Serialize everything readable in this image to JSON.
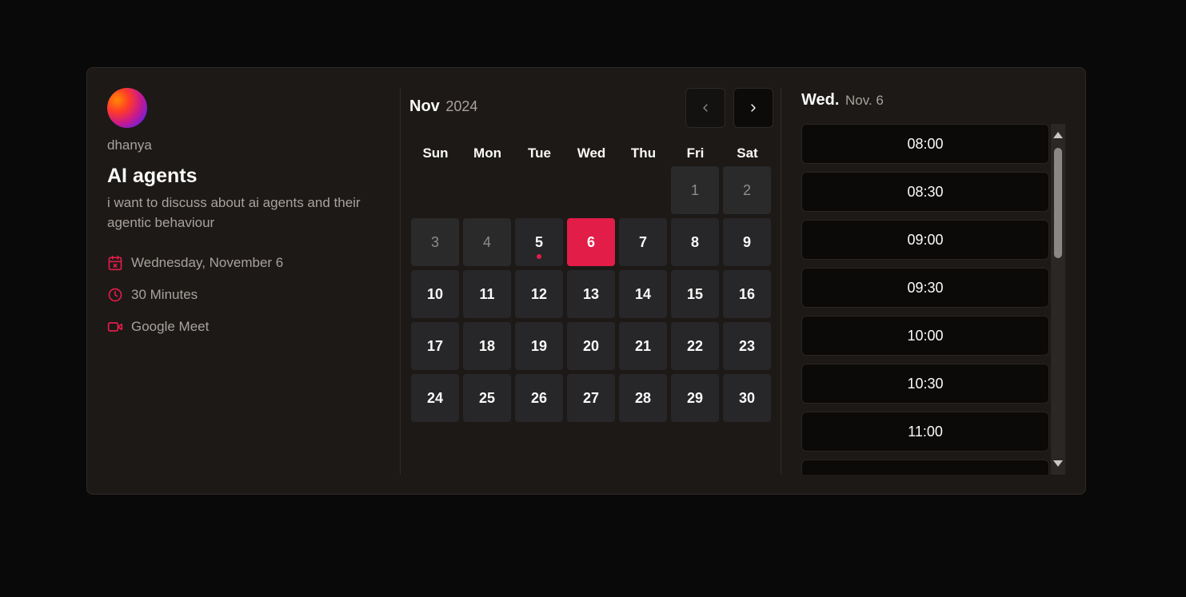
{
  "host": {
    "name": "dhanya"
  },
  "event": {
    "title": "AI agents",
    "description": "i want to discuss about ai agents and their agentic behaviour",
    "date": "Wednesday, November 6",
    "duration": "30 Minutes",
    "location": "Google Meet"
  },
  "calendar": {
    "month": "Nov",
    "year": "2024",
    "prev_icon": "chevron-left-icon",
    "next_icon": "chevron-right-icon",
    "weekdays": [
      "Sun",
      "Mon",
      "Tue",
      "Wed",
      "Thu",
      "Fri",
      "Sat"
    ],
    "days": [
      {
        "day": "1",
        "state": "past"
      },
      {
        "day": "2",
        "state": "past"
      },
      {
        "day": "3",
        "state": "past"
      },
      {
        "day": "4",
        "state": "past"
      },
      {
        "day": "5",
        "state": "today"
      },
      {
        "day": "6",
        "state": "selected"
      },
      {
        "day": "7"
      },
      {
        "day": "8"
      },
      {
        "day": "9"
      },
      {
        "day": "10"
      },
      {
        "day": "11"
      },
      {
        "day": "12"
      },
      {
        "day": "13"
      },
      {
        "day": "14"
      },
      {
        "day": "15"
      },
      {
        "day": "16"
      },
      {
        "day": "17"
      },
      {
        "day": "18"
      },
      {
        "day": "19"
      },
      {
        "day": "20"
      },
      {
        "day": "21"
      },
      {
        "day": "22"
      },
      {
        "day": "23"
      },
      {
        "day": "24"
      },
      {
        "day": "25"
      },
      {
        "day": "26"
      },
      {
        "day": "27"
      },
      {
        "day": "28"
      },
      {
        "day": "29"
      },
      {
        "day": "30"
      }
    ]
  },
  "times": {
    "day_label": "Wed.",
    "date_label": "Nov. 6",
    "slots": [
      "08:00",
      "08:30",
      "09:00",
      "09:30",
      "10:00",
      "10:30",
      "11:00",
      ""
    ]
  },
  "colors": {
    "accent": "#e11d48",
    "background": "#0a0909",
    "card": "#1c1917",
    "day_cell": "#27272a"
  }
}
